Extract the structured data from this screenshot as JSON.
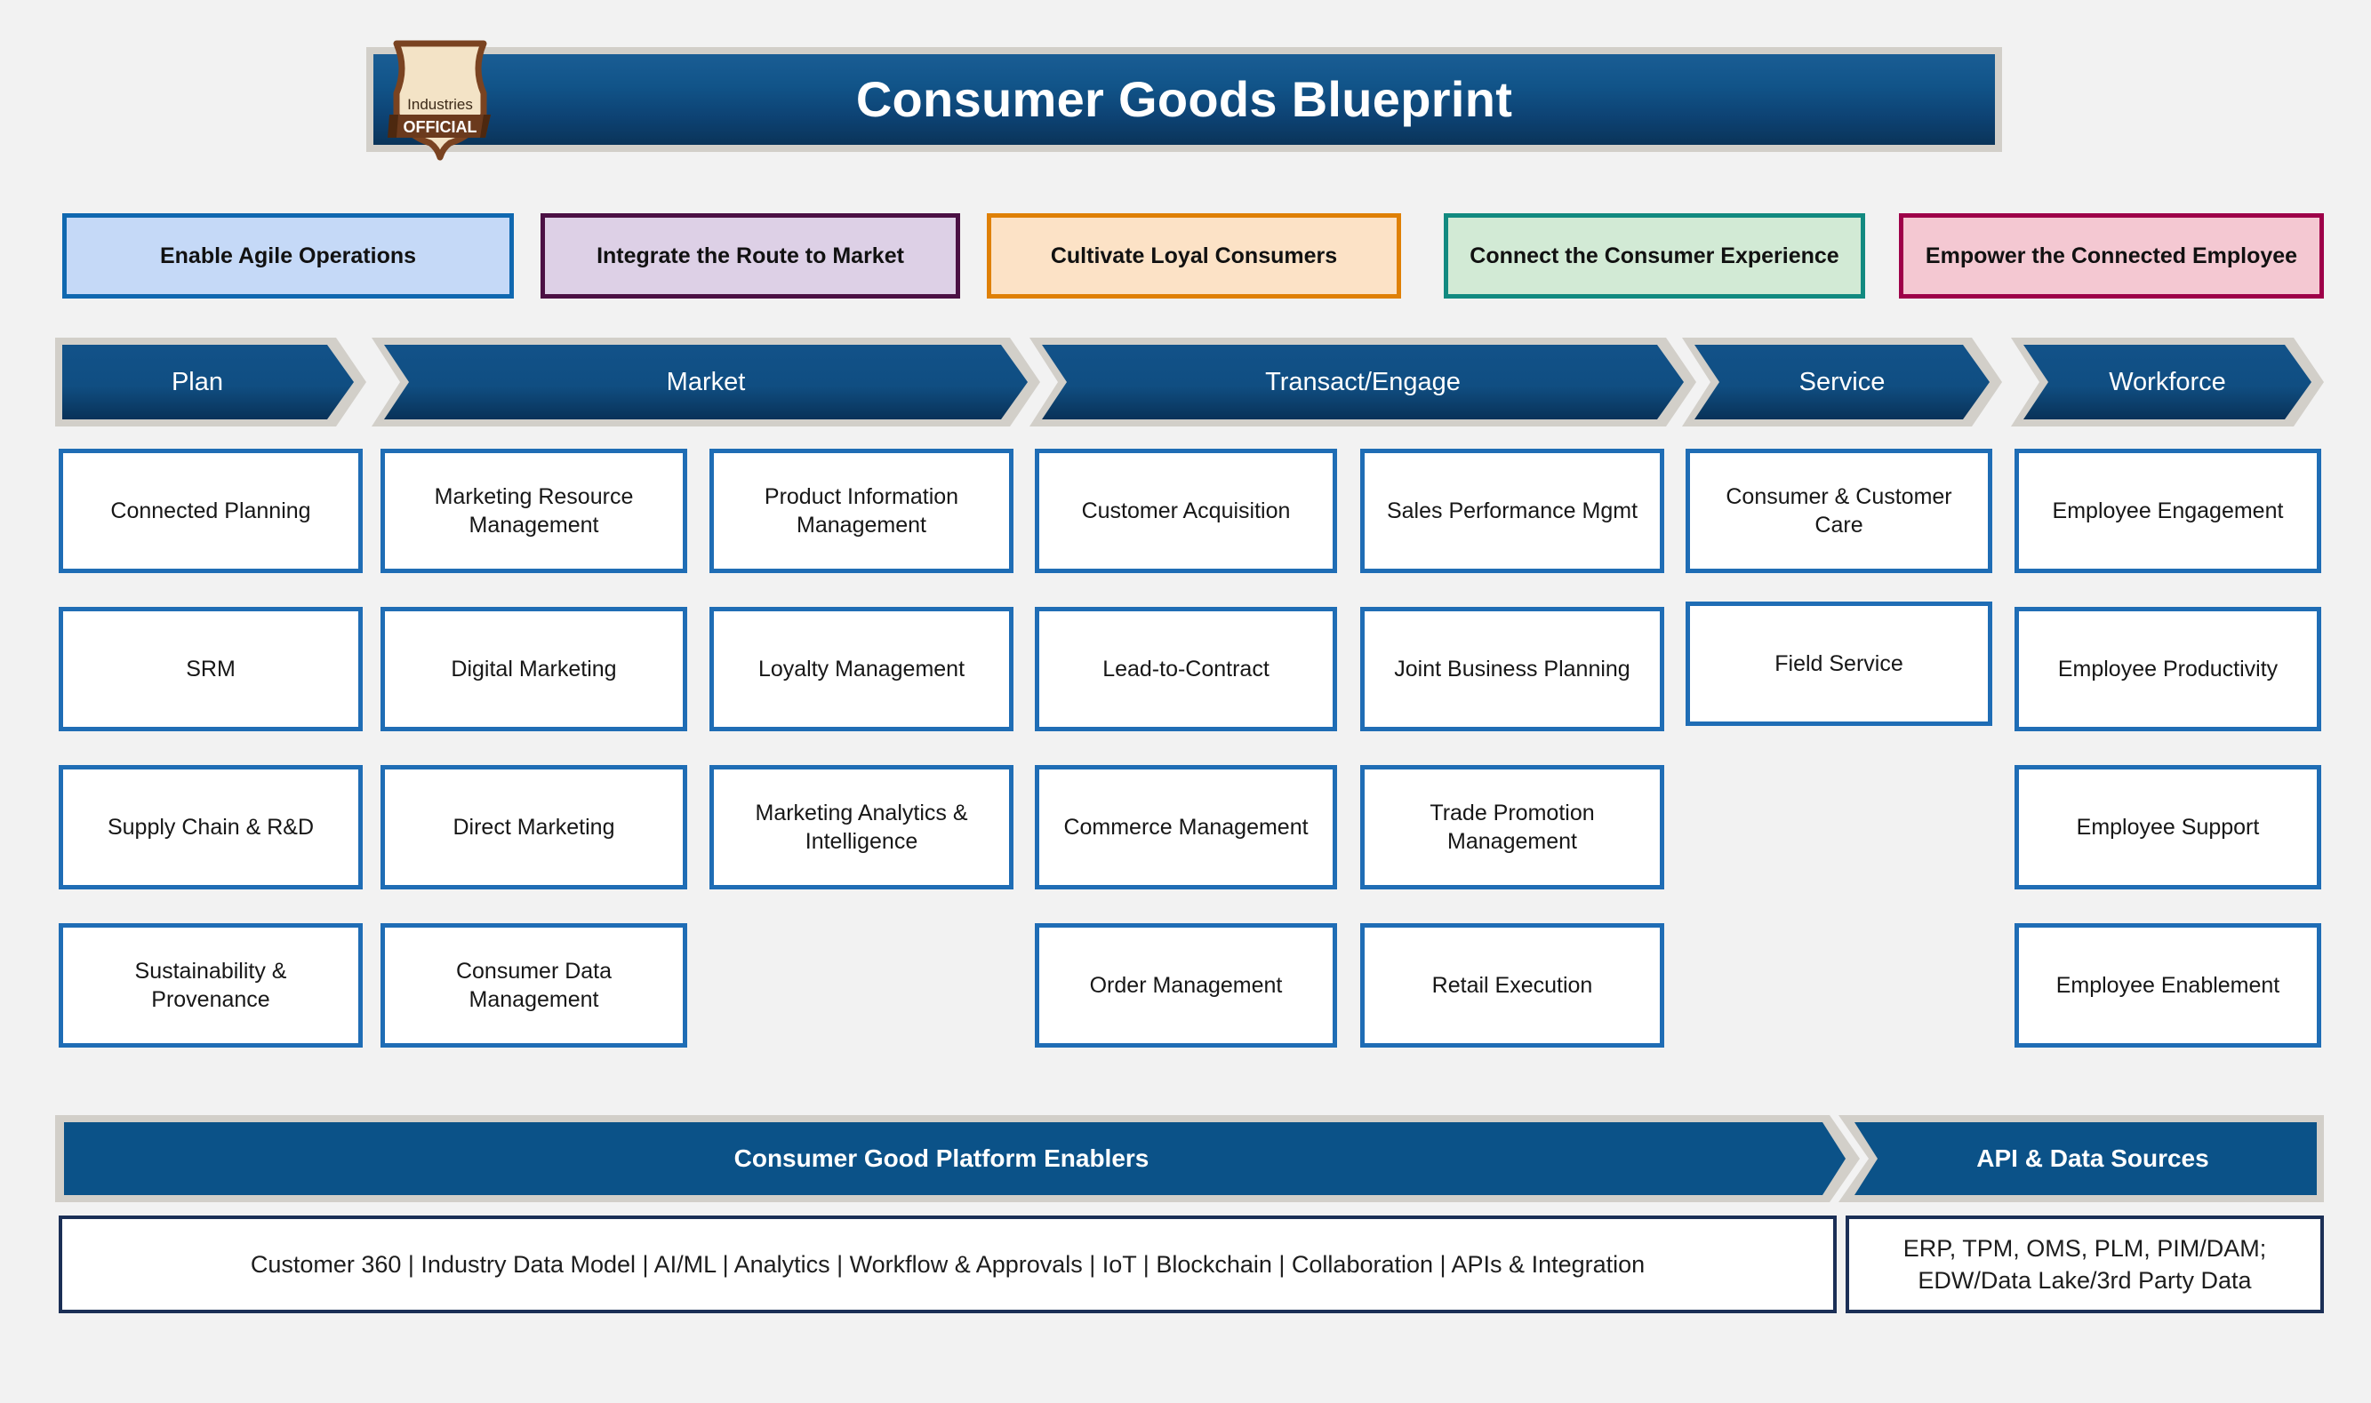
{
  "header": {
    "title": "Consumer Goods Blueprint",
    "badge": {
      "top_text": "Industries",
      "ribbon_text": "OFFICIAL"
    }
  },
  "pillars": [
    {
      "label": "Enable Agile Operations",
      "border": "#1068b0",
      "fill": "#c5d9f7"
    },
    {
      "label": "Integrate the Route to Market",
      "border": "#4b1044",
      "fill": "#ddd0e6"
    },
    {
      "label": "Cultivate Loyal Consumers",
      "border": "#df8006",
      "fill": "#fce2c6"
    },
    {
      "label": "Connect the Consumer Experience",
      "border": "#128a80",
      "fill": "#d2ead5"
    },
    {
      "label": "Empower the Connected Employee",
      "border": "#9e0049",
      "fill": "#f4c8d2"
    }
  ],
  "stages": [
    {
      "label": "Plan"
    },
    {
      "label": "Market"
    },
    {
      "label": "Transact/Engage"
    },
    {
      "label": "Service"
    },
    {
      "label": "Workforce"
    }
  ],
  "columns": [
    {
      "stage": "Plan",
      "cards": [
        "Connected Planning",
        "SRM",
        "Supply Chain & R&D",
        "Sustainability & Provenance"
      ]
    },
    {
      "stage": "Market",
      "cards": [
        "Marketing Resource Management",
        "Digital Marketing",
        "Direct Marketing",
        "Consumer Data Management"
      ]
    },
    {
      "stage": "Market",
      "cards": [
        "Product Information Management",
        "Loyalty Management",
        "Marketing Analytics & Intelligence",
        ""
      ]
    },
    {
      "stage": "Transact/Engage",
      "cards": [
        "Customer Acquisition",
        "Lead-to-Contract",
        "Commerce Management",
        "Order Management"
      ]
    },
    {
      "stage": "Transact/Engage",
      "cards": [
        "Sales Performance Mgmt",
        "Joint Business Planning",
        "Trade Promotion Management",
        "Retail Execution"
      ]
    },
    {
      "stage": "Service",
      "cards": [
        "Consumer & Customer Care",
        "Field Service",
        "",
        ""
      ]
    },
    {
      "stage": "Workforce",
      "cards": [
        "Employee Engagement",
        "Employee Productivity",
        "Employee Support",
        "Employee Enablement"
      ]
    }
  ],
  "footer": {
    "enablers_band": "Consumer Good Platform Enablers",
    "enablers_text": "Customer 360  |  Industry Data Model  |  AI/ML  |  Analytics  |  Workflow & Approvals  |  IoT  |  Blockchain  |  Collaboration  |  APIs & Integration",
    "api_band": "API & Data Sources",
    "api_line1": "ERP, TPM, OMS, PLM, PIM/DAM;",
    "api_line2": "EDW/Data Lake/3rd Party Data"
  },
  "colors": {
    "chevron_light": "#125289",
    "chevron_dark": "#093258",
    "chevron_outline": "#d2cfc9",
    "card_border": "#1f6db5",
    "strip_border": "#1b2f56",
    "background": "#f2f2f2"
  }
}
